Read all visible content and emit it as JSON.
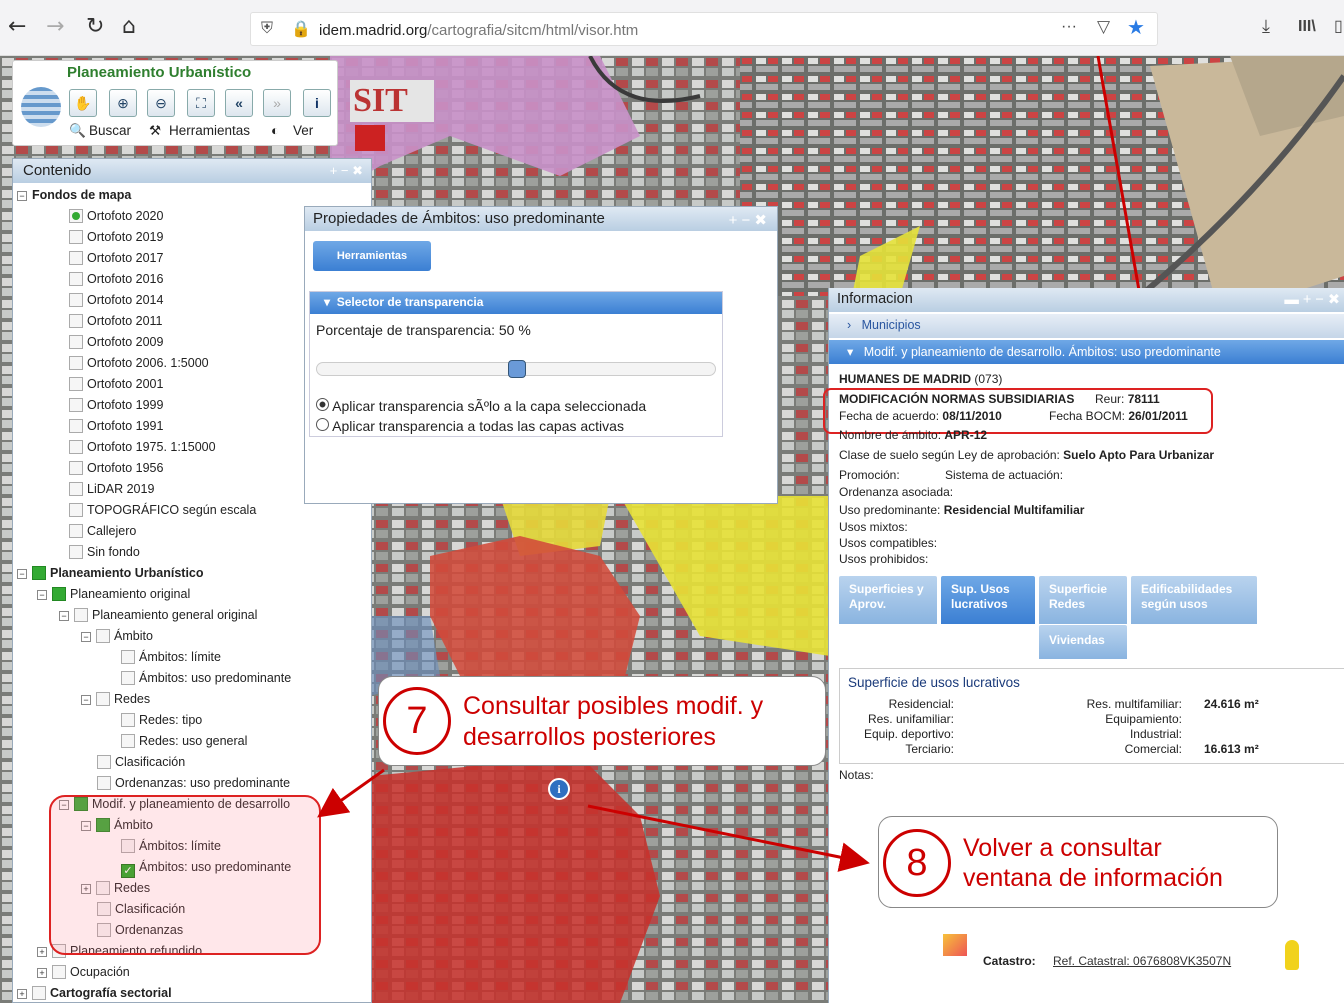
{
  "browser": {
    "back": "←",
    "forward": "→",
    "reload": "↻",
    "home": "⌂",
    "url_host": "idem.madrid.org",
    "url_path": "/cartografia/sitcm/html/visor.htm",
    "more": "···"
  },
  "app": {
    "title": "Planeamiento Urbanístico",
    "menu": [
      "Buscar",
      "Herramientas",
      "Ver"
    ],
    "logo": "SIT"
  },
  "contenido": {
    "title": "Contenido",
    "controls": "+ − ✖",
    "fondos": "Fondos de mapa",
    "layers": [
      "Ortofoto 2020",
      "Ortofoto 2019",
      "Ortofoto 2017",
      "Ortofoto 2016",
      "Ortofoto 2014",
      "Ortofoto 2011",
      "Ortofoto 2009",
      "Ortofoto 2006. 1:5000",
      "Ortofoto 2001",
      "Ortofoto 1999",
      "Ortofoto 1991",
      "Ortofoto 1975. 1:15000",
      "Ortofoto 1956",
      "LiDAR 2019",
      "TOPOGRÁFICO según escala",
      "Callejero",
      "Sin fondo"
    ],
    "plan": "Planeamiento Urbanístico",
    "original": "Planeamiento original",
    "general": "Planeamiento general original",
    "ambito": "Ámbito",
    "amb_limite": "Ámbitos: límite",
    "amb_uso": "Ámbitos: uso predominante",
    "redes": "Redes",
    "redes_tipo": "Redes: tipo",
    "redes_uso": "Redes: uso general",
    "clasif": "Clasificación",
    "ordenanzas_uso": "Ordenanzas: uso predominante",
    "modif": "Modif. y planeamiento de desarrollo",
    "ordenanzas": "Ordenanzas",
    "refundido": "Planeamiento refundido",
    "ocupacion": "Ocupación",
    "cartografia": "Cartografía sectorial"
  },
  "props": {
    "title": "Propiedades de Ámbitos: uso predominante",
    "tools": "Herramientas",
    "selector": "Selector de transparencia",
    "pct_label": "Porcentaje de transparencia:",
    "pct_value": "50 %",
    "opt1": "Aplicar transparencia sÃºlo a la capa seleccionada",
    "opt2": "Aplicar transparencia a todas las capas activas",
    "slider": 0.5
  },
  "info": {
    "title": "Informacion",
    "municipios": "Municipios",
    "section": "Modif. y planeamiento de desarrollo. Ámbitos: uso predominante",
    "municipio": "HUMANES DE MADRID",
    "code": "(073)",
    "norma": "MODIFICACIÓN NORMAS SUBSIDIARIAS",
    "reur_l": "Reur:",
    "reur": "78111",
    "fa_l": "Fecha de acuerdo:",
    "fa": "08/11/2010",
    "fb_l": "Fecha BOCM:",
    "fb": "26/01/2011",
    "nombre_l": "Nombre de ámbito:",
    "nombre": "APR-12",
    "clase_l": "Clase de suelo según Ley de aprobación:",
    "clase": "Suelo Apto Para Urbanizar",
    "prom": "Promoción:",
    "sist": "Sistema de actuación:",
    "ord": "Ordenanza asociada:",
    "uso_l": "Uso predominante:",
    "uso": "Residencial Multifamiliar",
    "mixtos": "Usos mixtos:",
    "compat": "Usos compatibles:",
    "prohib": "Usos prohibidos:",
    "tabs": [
      "Superficies y Aprov.",
      "Sup. Usos lucrativos",
      "Superficie Redes",
      "Edificabilidades según usos",
      "Viviendas"
    ],
    "sup_title": "Superficie de usos lucrativos",
    "res_uni": "Res. unifamiliar:",
    "resid": "Residencial:",
    "equip_dep": "Equip. deportivo:",
    "terc": "Terciario:",
    "res_mul": "Res. multifamiliar:",
    "res_mul_v": "24.616 m²",
    "equip": "Equipamiento:",
    "indus": "Industrial:",
    "com": "Comercial:",
    "com_v": "16.613 m²",
    "notas": "Notas:",
    "catastro_l": "Catastro:",
    "catastro": "Ref. Catastral: 0676808VK3507N"
  },
  "callouts": {
    "n7": "7",
    "t7a": "Consultar posibles modif. y",
    "t7b": "desarrollos posteriores",
    "n8": "8",
    "t8a": "Volver a consultar",
    "t8b": "ventana de información"
  }
}
